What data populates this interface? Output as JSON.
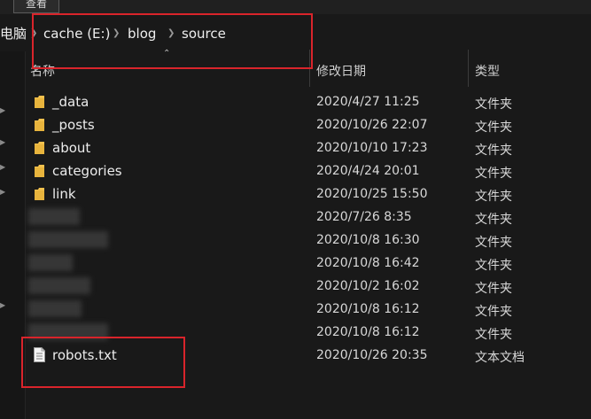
{
  "toolbar": {
    "view_label": "查看"
  },
  "address_bar": {
    "truncated_root": "电脑",
    "breadcrumbs": [
      "cache (E:)",
      "blog",
      "source"
    ]
  },
  "columns": {
    "name": "名称",
    "date_modified": "修改日期",
    "type": "类型"
  },
  "files": [
    {
      "name": "_data",
      "date": "2020/4/27 11:25",
      "type": "文件夹",
      "icon": "folder-icon"
    },
    {
      "name": "_posts",
      "date": "2020/10/26 22:07",
      "type": "文件夹",
      "icon": "folder-icon"
    },
    {
      "name": "about",
      "date": "2020/10/10 17:23",
      "type": "文件夹",
      "icon": "folder-icon"
    },
    {
      "name": "categories",
      "date": "2020/4/24 20:01",
      "type": "文件夹",
      "icon": "folder-icon"
    },
    {
      "name": "link",
      "date": "2020/10/25 15:50",
      "type": "文件夹",
      "icon": "folder-icon"
    },
    {
      "name": "",
      "date": "2020/7/26 8:35",
      "type": "文件夹",
      "icon": "blurred"
    },
    {
      "name": "",
      "date": "2020/10/8 16:30",
      "type": "文件夹",
      "icon": "blurred"
    },
    {
      "name": "",
      "date": "2020/10/8 16:42",
      "type": "文件夹",
      "icon": "blurred"
    },
    {
      "name": "",
      "date": "2020/10/2 16:02",
      "type": "文件夹",
      "icon": "blurred"
    },
    {
      "name": "",
      "date": "2020/10/8 16:12",
      "type": "文件夹",
      "icon": "blurred"
    },
    {
      "name": "",
      "date": "2020/10/8 16:12",
      "type": "文件夹",
      "icon": "blurred"
    },
    {
      "name": "robots.txt",
      "date": "2020/10/26 20:35",
      "type": "文本文档",
      "icon": "text-file-icon"
    }
  ],
  "colors": {
    "folder": "#f2c14e",
    "highlight_box": "#d9242b",
    "background": "#191919"
  }
}
